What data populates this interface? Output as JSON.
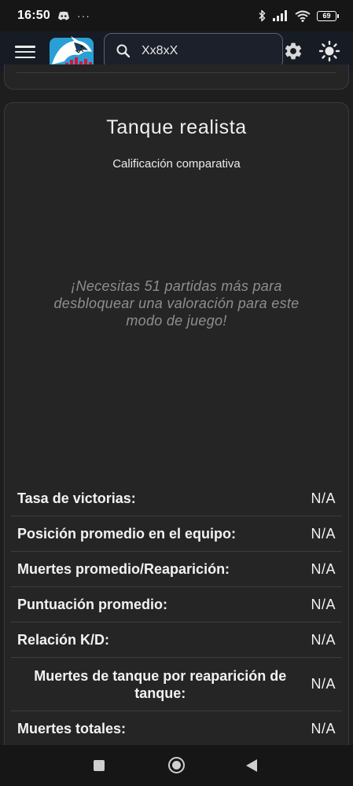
{
  "status_bar": {
    "time": "16:50",
    "dots": "···",
    "battery": "69",
    "icons": [
      "discord-icon",
      "bluetooth-icon",
      "signal-icon",
      "wifi-icon",
      "battery-icon"
    ]
  },
  "app_bar": {
    "search": {
      "value": "Xx8xX",
      "placeholder": ""
    },
    "icons": [
      "menu-icon",
      "shark-logo",
      "search-icon",
      "gear-icon",
      "sun-icon"
    ]
  },
  "card": {
    "title": "Tanque realista",
    "subtitle": "Calificación comparativa",
    "note": "¡Necesitas 51 partidas más para desbloquear una valoración para este modo de juego!",
    "stats": [
      {
        "label": "Tasa de victorias:",
        "value": "N/A"
      },
      {
        "label": "Posición promedio en el equipo:",
        "value": "N/A"
      },
      {
        "label": "Muertes promedio/Reaparición:",
        "value": "N/A"
      },
      {
        "label": "Puntuación promedio:",
        "value": "N/A"
      },
      {
        "label": "Relación K/D:",
        "value": "N/A"
      },
      {
        "label": "Muertes de tanque por reaparición de tanque:",
        "value": "N/A"
      },
      {
        "label": "Muertes totales:",
        "value": "N/A"
      }
    ]
  },
  "colors": {
    "background": "#1e1e1e",
    "card": "#252525",
    "appbar": "#161b24",
    "logo_blue": "#29a8e0",
    "logo_red": "#d9143a"
  }
}
